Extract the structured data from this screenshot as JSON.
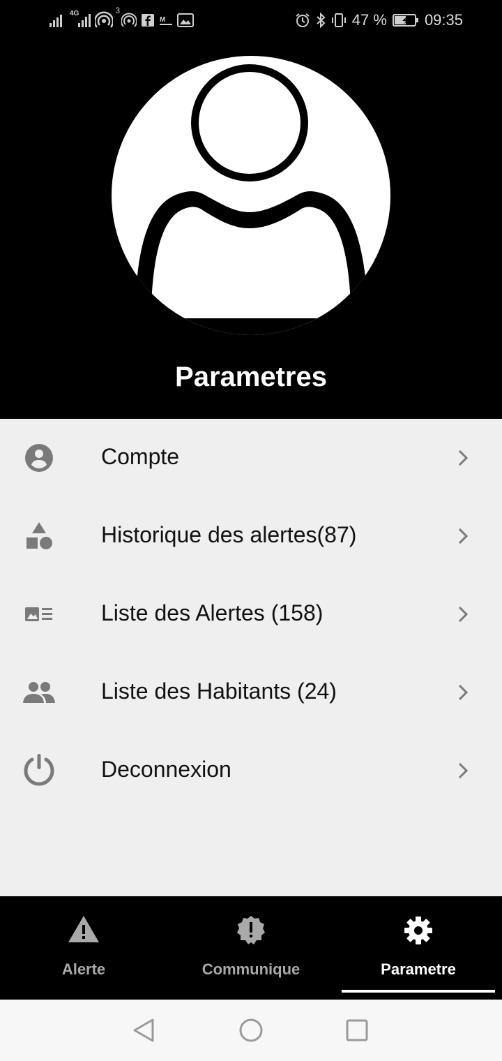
{
  "status_bar": {
    "battery_percent": "47 %",
    "time": "09:35",
    "signal_badge": "3",
    "network_label": "4G"
  },
  "header": {
    "title": "Parametres"
  },
  "menu": {
    "items": [
      {
        "label": "Compte",
        "icon": "account-circle-icon"
      },
      {
        "label": "Historique des alertes(87)",
        "icon": "shapes-icon"
      },
      {
        "label": "Liste des Alertes (158)",
        "icon": "image-list-icon"
      },
      {
        "label": "Liste des Habitants (24)",
        "icon": "people-icon"
      },
      {
        "label": "Deconnexion",
        "icon": "power-icon"
      }
    ]
  },
  "tabs": [
    {
      "label": "Alerte",
      "icon": "warning-icon",
      "active": false
    },
    {
      "label": "Communique",
      "icon": "announcement-icon",
      "active": false
    },
    {
      "label": "Parametre",
      "icon": "settings-icon",
      "active": true
    }
  ],
  "colors": {
    "header_bg": "#000000",
    "list_bg": "#efefef",
    "icon_gray": "#7a7a7a",
    "tab_inactive": "#a9a9a9",
    "tab_active": "#ffffff"
  }
}
